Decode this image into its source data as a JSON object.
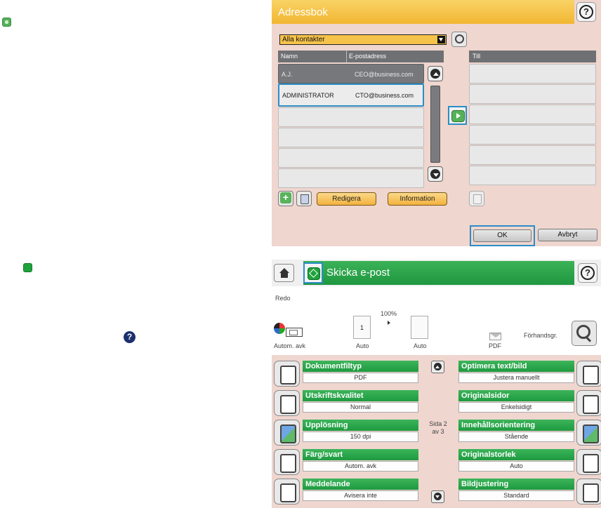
{
  "address_book": {
    "title": "Adressbok",
    "filter": "Alla kontakter",
    "columns": {
      "name": "Namn",
      "email": "E-postadress",
      "to": "Till"
    },
    "contacts": [
      {
        "name": "A.J.",
        "email": "CEO@business.com"
      },
      {
        "name": "ADMINISTRATOR",
        "email": "CTO@business.com"
      }
    ],
    "edit_label": "Redigera",
    "info_label": "Information",
    "ok_label": "OK",
    "cancel_label": "Avbryt"
  },
  "email": {
    "title": "Skicka e-post",
    "status": "Redo",
    "zoom": "100%",
    "page_count": "1",
    "color_label": "Autom. avk",
    "size1_label": "Auto",
    "size2_label": "Auto",
    "format_label": "PDF",
    "preview_label": "Förhandsgr.",
    "page_indicator": {
      "line1": "Sida 2",
      "line2": "av 3"
    },
    "options_left": [
      {
        "name": "Dokumentfiltyp",
        "value": "PDF"
      },
      {
        "name": "Utskriftskvalitet",
        "value": "Normal"
      },
      {
        "name": "Upplösning",
        "value": "150 dpi"
      },
      {
        "name": "Färg/svart",
        "value": "Autom. avk"
      },
      {
        "name": "Meddelande",
        "value": "Avisera inte"
      }
    ],
    "options_right": [
      {
        "name": "Optimera text/bild",
        "value": "Justera manuellt"
      },
      {
        "name": "Originalsidor",
        "value": "Enkelsidigt"
      },
      {
        "name": "Innehållsorientering",
        "value": "Stående"
      },
      {
        "name": "Originalstorlek",
        "value": "Auto"
      },
      {
        "name": "Bildjustering",
        "value": "Standard"
      }
    ]
  },
  "colors": {
    "address_title": "#f2b632",
    "email_title": "#1f9740",
    "selection_border": "#2a8ec8",
    "panel_bg": "#efd6cf"
  }
}
